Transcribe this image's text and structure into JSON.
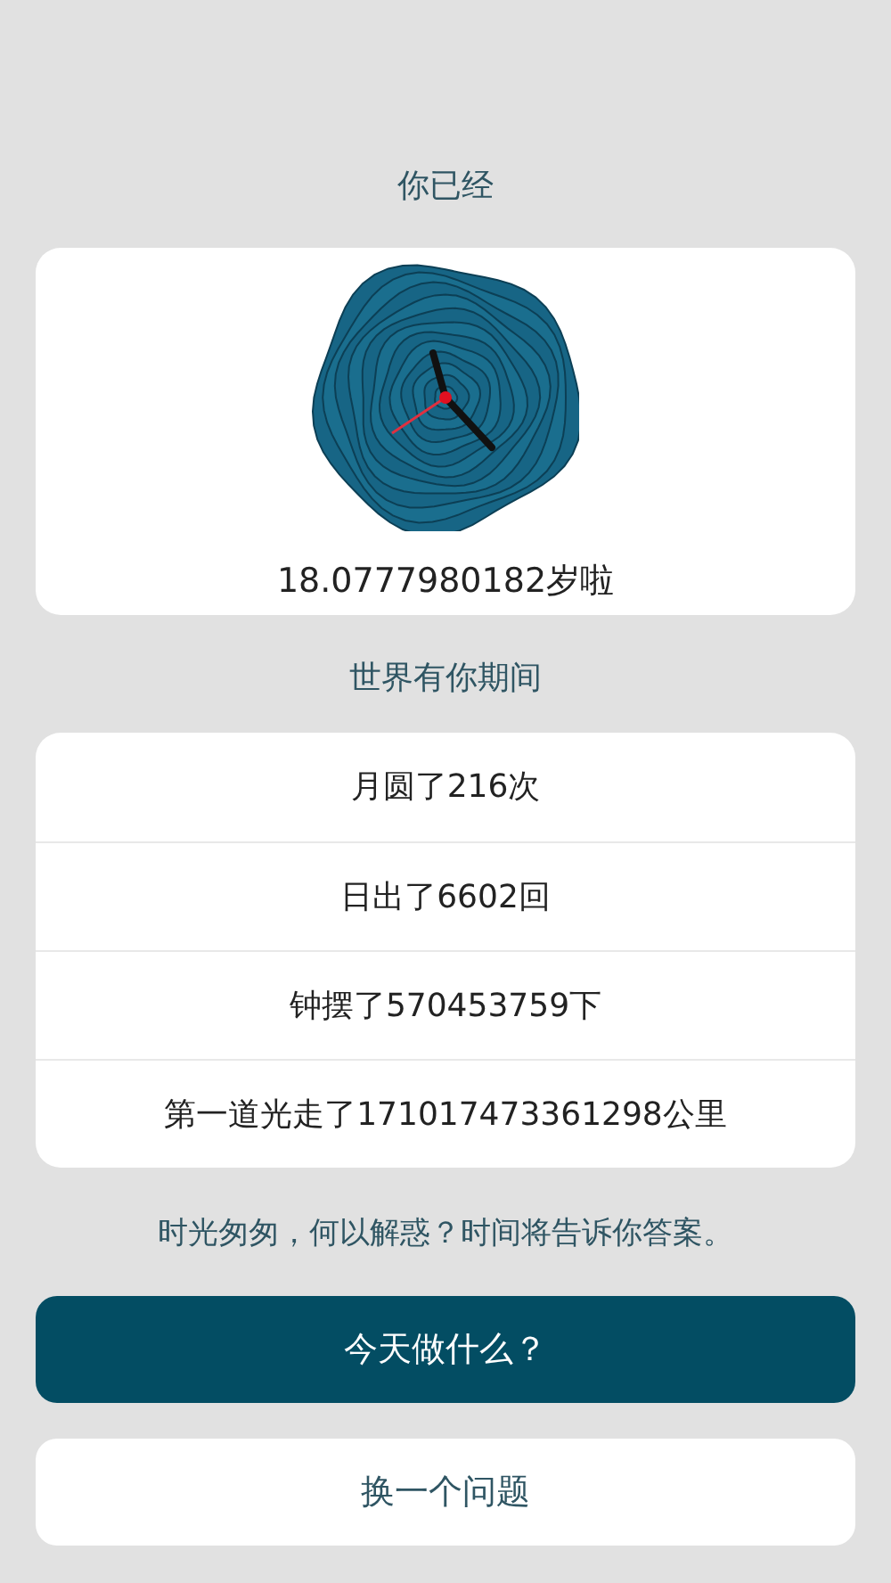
{
  "age_section": {
    "heading": "你已经",
    "age": "18.0777980182岁啦"
  },
  "world_section": {
    "heading": "世界有你期间",
    "stats": [
      "月圆了216次",
      "日出了6602回",
      "钟摆了570453759下",
      "第一道光走了171017473361298公里"
    ]
  },
  "tagline": "时光匆匆，何以解惑？时间将告诉你答案。",
  "buttons": [
    {
      "label": "今天做什么？",
      "kind": "primary"
    },
    {
      "label": "换一个问题",
      "kind": "secondary"
    }
  ]
}
